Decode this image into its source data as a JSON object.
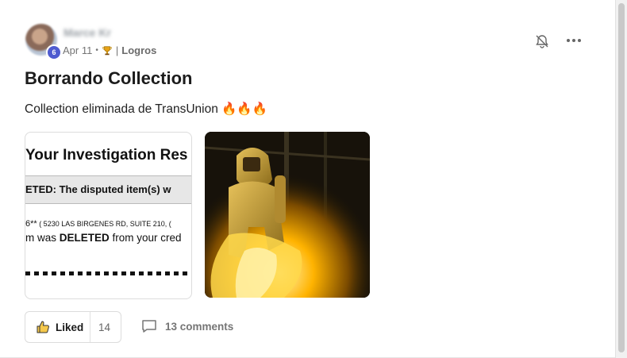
{
  "post": {
    "author": "Marce Kr",
    "date": "Apr 11",
    "separator": "•",
    "category_prefix": "|",
    "category": "Logros",
    "title": "Borrando Collection",
    "body": "Collection eliminada de TransUnion 🔥🔥🔥"
  },
  "attachment_1": {
    "heading": "Your Investigation Res",
    "band_text": "ETED:  The disputed item(s) w",
    "line1_prefix": "6**",
    "line1_small": " ( 5230 LAS BIRGENES RD, SUITE 210, (",
    "line2_before": "m was ",
    "line2_bold": "DELETED",
    "line2_after": " from your cred"
  },
  "actions": {
    "like_label": "Liked",
    "like_count": "14",
    "comments_label": "13 comments"
  },
  "icons": {
    "bell": "bell-off-icon",
    "more": "more-horizontal-icon",
    "thumb": "thumbs-up-icon",
    "comment": "comment-icon",
    "trophy": "trophy-icon"
  },
  "colors": {
    "badge": "#4e5bd0",
    "thumb_fill": "#f5c84c"
  }
}
